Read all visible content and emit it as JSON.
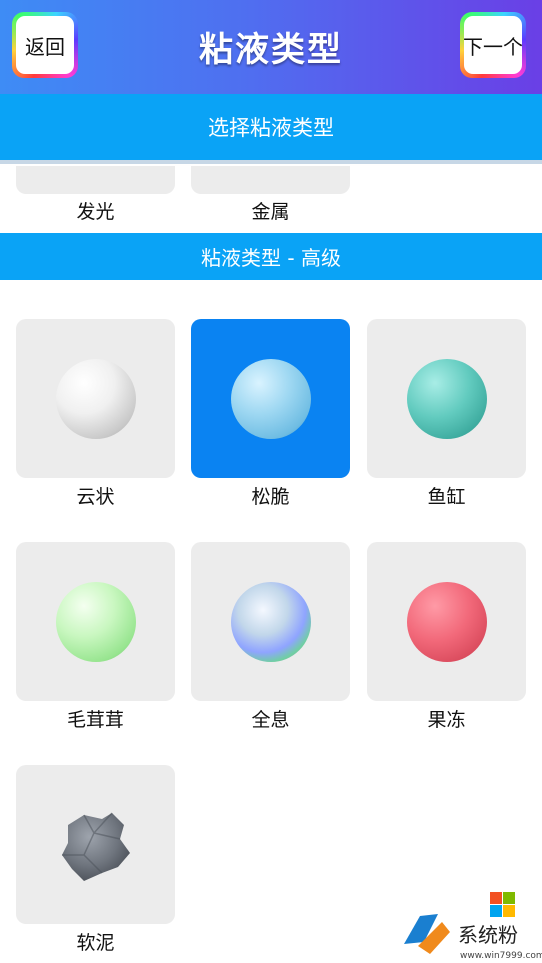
{
  "header": {
    "title": "粘液类型",
    "back_label": "返回",
    "next_label": "下一个"
  },
  "section_bar": "选择粘液类型",
  "basic_partial": [
    {
      "label": "发光"
    },
    {
      "label": "金属"
    }
  ],
  "advanced_header": "粘液类型 - 高级",
  "advanced_items": [
    {
      "label": "云状",
      "icon": "cloud-slime-ball-icon",
      "selected": false
    },
    {
      "label": "松脆",
      "icon": "crispy-slime-ball-icon",
      "selected": true
    },
    {
      "label": "鱼缸",
      "icon": "fishbowl-slime-ball-icon",
      "selected": false
    },
    {
      "label": "毛茸茸",
      "icon": "fluffy-slime-ball-icon",
      "selected": false
    },
    {
      "label": "全息",
      "icon": "holographic-slime-ball-icon",
      "selected": false
    },
    {
      "label": "果冻",
      "icon": "jelly-slime-ball-icon",
      "selected": false
    },
    {
      "label": "软泥",
      "icon": "soft-clay-blob-icon",
      "selected": false
    }
  ],
  "colors": {
    "accent": "#0aa3f6",
    "selected": "#0a83f2",
    "card": "#ececec"
  },
  "watermark": {
    "text": "系统粉",
    "url": "www.win7999.com"
  }
}
